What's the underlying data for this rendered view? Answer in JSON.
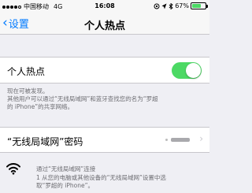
{
  "status_bar": {
    "carrier": "中国移动",
    "network": "4G",
    "time": "16:08",
    "battery": "67%",
    "battery_level": 0.67,
    "battery_color": "#4cd964"
  },
  "nav": {
    "back_label": "设置",
    "title": "个人热点"
  },
  "hotspot": {
    "label": "个人热点",
    "enabled": true,
    "toggle_color": "#4cd964"
  },
  "discovery": {
    "line1": "现在可被发现。",
    "line2": "其他用户可以通过“无线局域网”和蓝牙查找您的名为“罗超",
    "line3": "的 iPhone”的共享网络。"
  },
  "password": {
    "label": "“无线局域网”密码"
  },
  "instructions": {
    "icon": "wifi-icon",
    "title": "通过“无线局域网”连接",
    "body_line1": "1 从您的电脑或其他设备的“无线局域网”设置中选",
    "body_line2": "取“罗超的 iPhone”。"
  },
  "colors": {
    "accent": "#007aff",
    "background": "#efeff4"
  }
}
